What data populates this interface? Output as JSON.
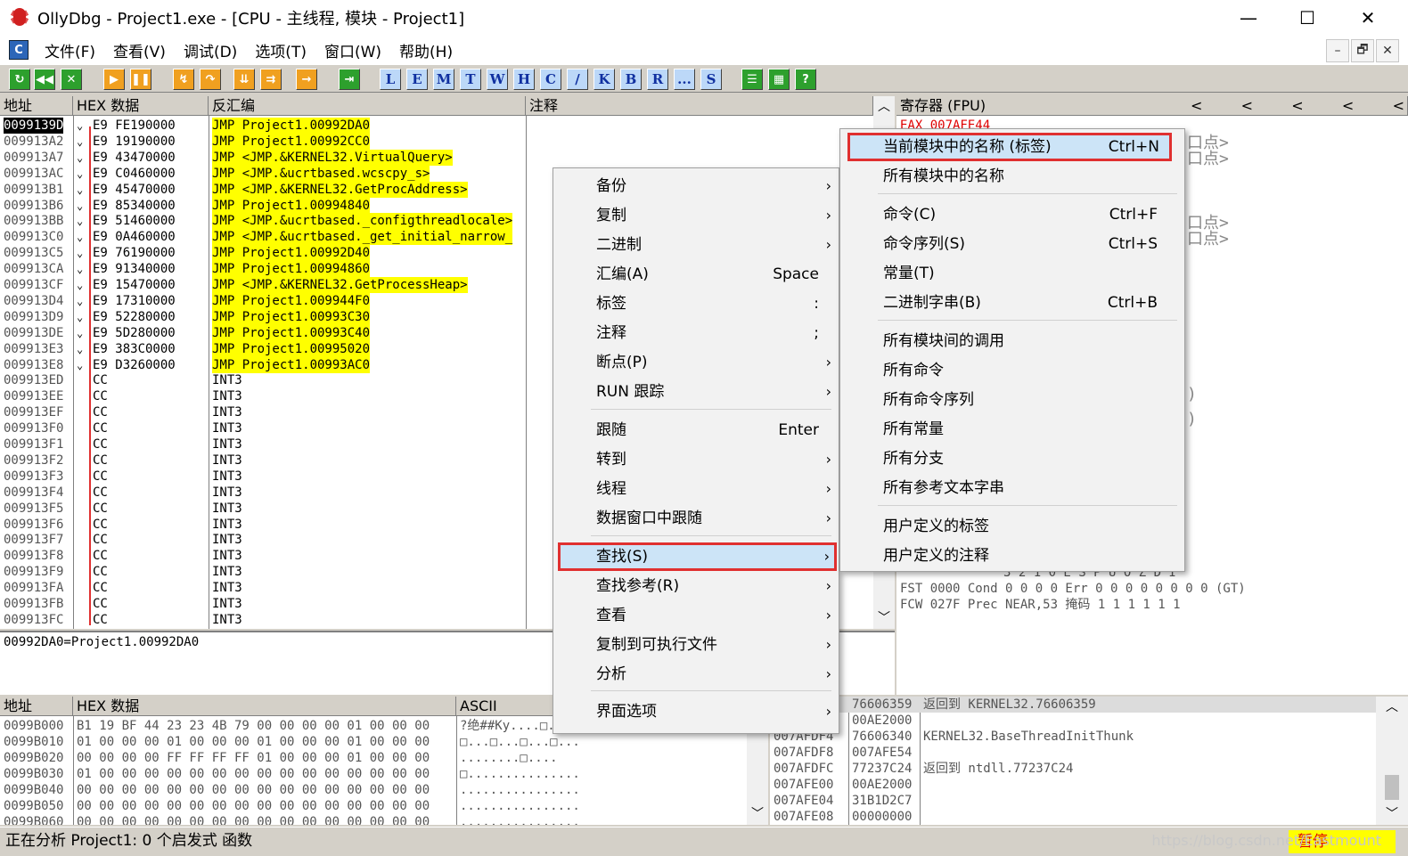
{
  "window": {
    "title": "OllyDbg - Project1.exe - [CPU - 主线程, 模块 - Project1]",
    "minimize": "—",
    "maximize": "☐",
    "close": "✕"
  },
  "menubar": {
    "icon": "C",
    "items": [
      "文件(F)",
      "查看(V)",
      "调试(D)",
      "选项(T)",
      "窗口(W)",
      "帮助(H)"
    ],
    "mdi": [
      "–",
      "🗗",
      "✕"
    ]
  },
  "toolbar": {
    "letters": [
      "L",
      "E",
      "M",
      "T",
      "W",
      "H",
      "C",
      "/",
      "K",
      "B",
      "R",
      "...",
      "S"
    ]
  },
  "disasm": {
    "headers": {
      "address": "地址",
      "hex": "HEX 数据",
      "disasm": "反汇编",
      "comment": "注释"
    },
    "rows": [
      {
        "addr": "0099139D",
        "mark": "⌄",
        "hex": "E9 FE190000",
        "asm": "JMP Project1.00992DA0",
        "hl": true,
        "sel": true
      },
      {
        "addr": "009913A2",
        "mark": "⌄",
        "hex": "E9 19190000",
        "asm": "JMP Project1.00992CC0",
        "hl": true
      },
      {
        "addr": "009913A7",
        "mark": "⌄",
        "hex": "E9 43470000",
        "asm": "JMP <JMP.&KERNEL32.VirtualQuery>",
        "hl": true
      },
      {
        "addr": "009913AC",
        "mark": "⌄",
        "hex": "E9 C0460000",
        "asm": "JMP <JMP.&ucrtbased.wcscpy_s>",
        "hl": true
      },
      {
        "addr": "009913B1",
        "mark": "⌄",
        "hex": "E9 45470000",
        "asm": "JMP <JMP.&KERNEL32.GetProcAddress>",
        "hl": true
      },
      {
        "addr": "009913B6",
        "mark": "⌄",
        "hex": "E9 85340000",
        "asm": "JMP Project1.00994840",
        "hl": true
      },
      {
        "addr": "009913BB",
        "mark": "⌄",
        "hex": "E9 51460000",
        "asm": "JMP <JMP.&ucrtbased._configthreadlocale>",
        "hl": true
      },
      {
        "addr": "009913C0",
        "mark": "⌄",
        "hex": "E9 0A460000",
        "asm": "JMP <JMP.&ucrtbased._get_initial_narrow_",
        "hl": true
      },
      {
        "addr": "009913C5",
        "mark": "⌄",
        "hex": "E9 76190000",
        "asm": "JMP Project1.00992D40",
        "hl": true
      },
      {
        "addr": "009913CA",
        "mark": "⌄",
        "hex": "E9 91340000",
        "asm": "JMP Project1.00994860",
        "hl": true
      },
      {
        "addr": "009913CF",
        "mark": "⌄",
        "hex": "E9 15470000",
        "asm": "JMP <JMP.&KERNEL32.GetProcessHeap>",
        "hl": true
      },
      {
        "addr": "009913D4",
        "mark": "⌄",
        "hex": "E9 17310000",
        "asm": "JMP Project1.009944F0",
        "hl": true
      },
      {
        "addr": "009913D9",
        "mark": "⌄",
        "hex": "E9 52280000",
        "asm": "JMP Project1.00993C30",
        "hl": true
      },
      {
        "addr": "009913DE",
        "mark": "⌄",
        "hex": "E9 5D280000",
        "asm": "JMP Project1.00993C40",
        "hl": true
      },
      {
        "addr": "009913E3",
        "mark": "⌄",
        "hex": "E9 383C0000",
        "asm": "JMP Project1.00995020",
        "hl": true
      },
      {
        "addr": "009913E8",
        "mark": "⌄",
        "hex": "E9 D3260000",
        "asm": "JMP Project1.00993AC0",
        "hl": true
      },
      {
        "addr": "009913ED",
        "mark": "",
        "hex": "CC",
        "asm": "INT3"
      },
      {
        "addr": "009913EE",
        "mark": "",
        "hex": "CC",
        "asm": "INT3"
      },
      {
        "addr": "009913EF",
        "mark": "",
        "hex": "CC",
        "asm": "INT3"
      },
      {
        "addr": "009913F0",
        "mark": "",
        "hex": "CC",
        "asm": "INT3"
      },
      {
        "addr": "009913F1",
        "mark": "",
        "hex": "CC",
        "asm": "INT3"
      },
      {
        "addr": "009913F2",
        "mark": "",
        "hex": "CC",
        "asm": "INT3"
      },
      {
        "addr": "009913F3",
        "mark": "",
        "hex": "CC",
        "asm": "INT3"
      },
      {
        "addr": "009913F4",
        "mark": "",
        "hex": "CC",
        "asm": "INT3"
      },
      {
        "addr": "009913F5",
        "mark": "",
        "hex": "CC",
        "asm": "INT3"
      },
      {
        "addr": "009913F6",
        "mark": "",
        "hex": "CC",
        "asm": "INT3"
      },
      {
        "addr": "009913F7",
        "mark": "",
        "hex": "CC",
        "asm": "INT3"
      },
      {
        "addr": "009913F8",
        "mark": "",
        "hex": "CC",
        "asm": "INT3"
      },
      {
        "addr": "009913F9",
        "mark": "",
        "hex": "CC",
        "asm": "INT3"
      },
      {
        "addr": "009913FA",
        "mark": "",
        "hex": "CC",
        "asm": "INT3"
      },
      {
        "addr": "009913FB",
        "mark": "",
        "hex": "CC",
        "asm": "INT3"
      },
      {
        "addr": "009913FC",
        "mark": "",
        "hex": "CC",
        "asm": "INT3"
      }
    ]
  },
  "info": {
    "text": "00992DA0=Project1.00992DA0"
  },
  "registers": {
    "header": "寄存器 (FPU)",
    "nav": [
      "<",
      "<",
      "<",
      "<",
      "<"
    ],
    "eax": "EAX 007AFE44",
    "fragments": [
      "口点>",
      "口点>",
      "口点>",
      "口点>",
      ")",
      ")"
    ],
    "fst_row": "FST 0000  Cond 0 0 0 0  Err 0 0 0 0 0 0 0 0  (GT)",
    "fcw_row": "FCW 027F  Prec NEAR,53  掩码    1 1 1 1 1 1",
    "flags_row": "3 2 1 0     E S P U O Z D I"
  },
  "dump": {
    "headers": {
      "address": "地址",
      "hex": "HEX 数据",
      "ascii": "ASCII"
    },
    "rows": [
      {
        "addr": "0099B000",
        "hex": "B1 19 BF 44 23 23 4B 79 00 00 00 00 01 00 00 00",
        "ascii": "?绝##Ky....□..."
      },
      {
        "addr": "0099B010",
        "hex": "01 00 00 00 01 00 00 00 01 00 00 00 01 00 00 00",
        "ascii": "□...□...□...□..."
      },
      {
        "addr": "0099B020",
        "hex": "00 00 00 00 FF FF FF FF 01 00 00 00 01 00 00 00",
        "ascii": "........□...."
      },
      {
        "addr": "0099B030",
        "hex": "01 00 00 00 00 00 00 00 00 00 00 00 00 00 00 00",
        "ascii": "□..............."
      },
      {
        "addr": "0099B040",
        "hex": "00 00 00 00 00 00 00 00 00 00 00 00 00 00 00 00",
        "ascii": "................"
      },
      {
        "addr": "0099B050",
        "hex": "00 00 00 00 00 00 00 00 00 00 00 00 00 00 00 00",
        "ascii": "................"
      },
      {
        "addr": "0099B060",
        "hex": "00 00 00 00 00 00 00 00 00 00 00 00 00 00 00 00",
        "ascii": "................"
      }
    ]
  },
  "stack": {
    "rows": [
      {
        "addr": "",
        "val": "76606359",
        "cmt": "返回到 KERNEL32.76606359",
        "hl": true
      },
      {
        "addr": "",
        "val": "00AE2000",
        "cmt": ""
      },
      {
        "addr": "007AFDF4",
        "val": "76606340",
        "cmt": "KERNEL32.BaseThreadInitThunk"
      },
      {
        "addr": "007AFDF8",
        "val": "007AFE54",
        "cmt": ""
      },
      {
        "addr": "007AFDFC",
        "val": "77237C24",
        "cmt": "返回到 ntdll.77237C24"
      },
      {
        "addr": "007AFE00",
        "val": "00AE2000",
        "cmt": ""
      },
      {
        "addr": "007AFE04",
        "val": "31B1D2C7",
        "cmt": ""
      },
      {
        "addr": "007AFE08",
        "val": "00000000",
        "cmt": ""
      }
    ]
  },
  "context_menu": {
    "items": [
      {
        "label": "备份",
        "shortcut": "",
        "arrow": "›"
      },
      {
        "label": "复制",
        "shortcut": "",
        "arrow": "›"
      },
      {
        "label": "二进制",
        "shortcut": "",
        "arrow": "›"
      },
      {
        "label": "汇编(A)",
        "shortcut": "Space",
        "arrow": ""
      },
      {
        "label": "标签",
        "shortcut": ":",
        "arrow": ""
      },
      {
        "label": "注释",
        "shortcut": ";",
        "arrow": ""
      },
      {
        "label": "断点(P)",
        "shortcut": "",
        "arrow": "›"
      },
      {
        "label": "RUN 跟踪",
        "shortcut": "",
        "arrow": "›"
      },
      {
        "label": "跟随",
        "shortcut": "Enter",
        "arrow": ""
      },
      {
        "label": "转到",
        "shortcut": "",
        "arrow": "›"
      },
      {
        "label": "线程",
        "shortcut": "",
        "arrow": "›"
      },
      {
        "label": "数据窗口中跟随",
        "shortcut": "",
        "arrow": "›"
      },
      {
        "label": "查找(S)",
        "shortcut": "",
        "arrow": "›"
      },
      {
        "label": "查找参考(R)",
        "shortcut": "",
        "arrow": "›"
      },
      {
        "label": "查看",
        "shortcut": "",
        "arrow": "›"
      },
      {
        "label": "复制到可执行文件",
        "shortcut": "",
        "arrow": "›"
      },
      {
        "label": "分析",
        "shortcut": "",
        "arrow": "›"
      },
      {
        "label": "界面选项",
        "shortcut": "",
        "arrow": "›"
      }
    ]
  },
  "submenu": {
    "items": [
      {
        "label": "当前模块中的名称 (标签)",
        "shortcut": "Ctrl+N"
      },
      {
        "label": "所有模块中的名称",
        "shortcut": ""
      },
      {
        "label": "命令(C)",
        "shortcut": "Ctrl+F"
      },
      {
        "label": "命令序列(S)",
        "shortcut": "Ctrl+S"
      },
      {
        "label": "常量(T)",
        "shortcut": ""
      },
      {
        "label": "二进制字串(B)",
        "shortcut": "Ctrl+B"
      },
      {
        "label": "所有模块间的调用",
        "shortcut": ""
      },
      {
        "label": "所有命令",
        "shortcut": ""
      },
      {
        "label": "所有命令序列",
        "shortcut": ""
      },
      {
        "label": "所有常量",
        "shortcut": ""
      },
      {
        "label": "所有分支",
        "shortcut": ""
      },
      {
        "label": "所有参考文本字串",
        "shortcut": ""
      },
      {
        "label": "用户定义的标签",
        "shortcut": ""
      },
      {
        "label": "用户定义的注释",
        "shortcut": ""
      }
    ]
  },
  "status": {
    "text": "正在分析 Project1: 0 个启发式 函数",
    "paused": "暂停",
    "watermark": "https://blog.csdn.net/Eastmount"
  }
}
